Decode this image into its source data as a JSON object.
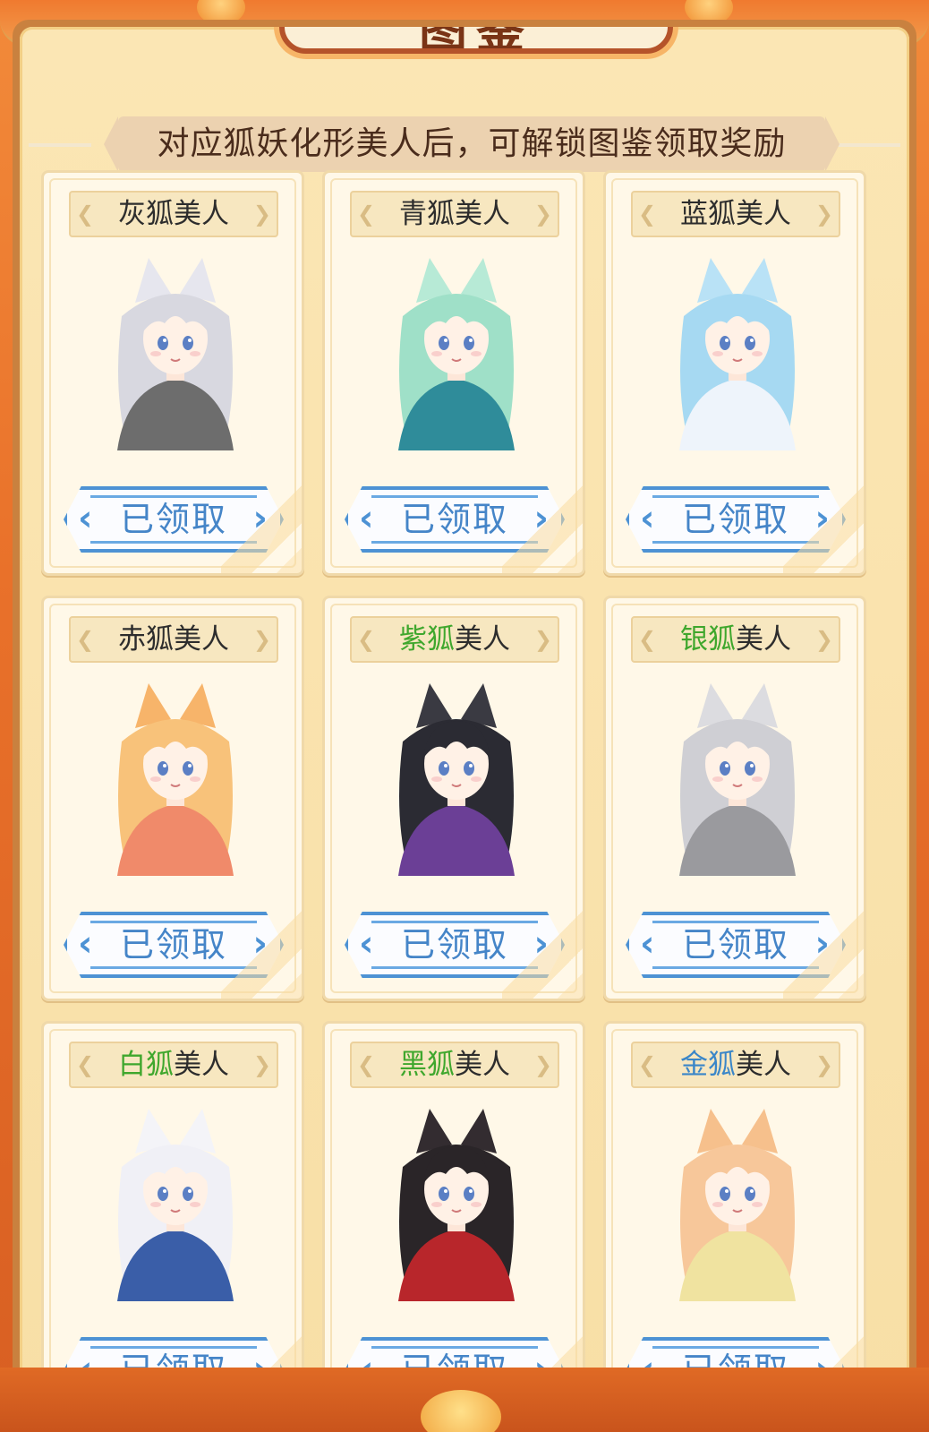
{
  "header": {
    "title": "图鉴"
  },
  "subtitle": "对应狐妖化形美人后，可解锁图鉴领取奖励",
  "cards": [
    {
      "name_colored": "",
      "name_plain": "灰狐美人",
      "accent": "none",
      "button": "已领取",
      "hair": "#d8d8e0",
      "outfit": "#6d6d6d",
      "ear": "#e6e6ee"
    },
    {
      "name_colored": "",
      "name_plain": "青狐美人",
      "accent": "none",
      "button": "已领取",
      "hair": "#9fe0c8",
      "outfit": "#2f8c9a",
      "ear": "#b7ead6"
    },
    {
      "name_colored": "",
      "name_plain": "蓝狐美人",
      "accent": "none",
      "button": "已领取",
      "hair": "#a6d9f2",
      "outfit": "#eef4fb",
      "ear": "#b9e2f6"
    },
    {
      "name_colored": "",
      "name_plain": "赤狐美人",
      "accent": "none",
      "button": "已领取",
      "hair": "#f8c27a",
      "outfit": "#f08a6a",
      "ear": "#f7b46a"
    },
    {
      "name_colored": "紫狐",
      "name_plain": "美人",
      "accent": "green",
      "button": "已领取",
      "hair": "#2b2b33",
      "outfit": "#6b3f96",
      "ear": "#3a3a42"
    },
    {
      "name_colored": "银狐",
      "name_plain": "美人",
      "accent": "green",
      "button": "已领取",
      "hair": "#cfcfd4",
      "outfit": "#9a9a9e",
      "ear": "#dcdce0"
    },
    {
      "name_colored": "白狐",
      "name_plain": "美人",
      "accent": "green",
      "button": "已领取",
      "hair": "#f0f0f6",
      "outfit": "#3a5ea8",
      "ear": "#f4f4f8"
    },
    {
      "name_colored": "黑狐",
      "name_plain": "美人",
      "accent": "green",
      "button": "已领取",
      "hair": "#2a2528",
      "outfit": "#b8262b",
      "ear": "#332c30"
    },
    {
      "name_colored": "金狐",
      "name_plain": "美人",
      "accent": "blue",
      "button": "已领取",
      "hair": "#f7c79a",
      "outfit": "#f0e3a0",
      "ear": "#f6c08c"
    }
  ],
  "colors": {
    "frame_orange": "#e9712a",
    "panel_cream": "#fbe6b4",
    "button_blue": "#4585c8",
    "accent_green": "#3fa72d",
    "accent_blue": "#3a86c8"
  },
  "icons": [
    "fox-girl-portrait",
    "chevron-left-icon",
    "chevron-right-icon"
  ]
}
